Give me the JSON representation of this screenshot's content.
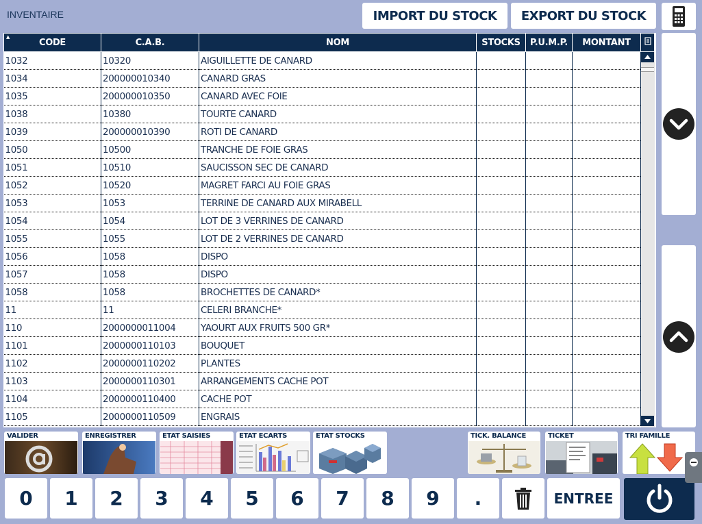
{
  "window": {
    "title": "INVENTAIRE"
  },
  "toolbar": {
    "import_label": "IMPORT DU STOCK",
    "export_label": "EXPORT DU STOCK"
  },
  "table": {
    "columns": [
      "CODE",
      "C.A.B.",
      "NOM",
      "STOCKS",
      "P.U.M.P.",
      "MONTANT"
    ],
    "rows": [
      [
        "1032",
        "10320",
        "AIGUILLETTE DE CANARD",
        "",
        "",
        ""
      ],
      [
        "1034",
        "200000010340",
        "CANARD GRAS",
        "",
        "",
        ""
      ],
      [
        "1035",
        "200000010350",
        "CANARD AVEC FOIE",
        "",
        "",
        ""
      ],
      [
        "1038",
        "10380",
        "TOURTE CANARD",
        "",
        "",
        ""
      ],
      [
        "1039",
        "200000010390",
        "ROTI DE CANARD",
        "",
        "",
        ""
      ],
      [
        "1050",
        "10500",
        "TRANCHE DE FOIE GRAS",
        "",
        "",
        ""
      ],
      [
        "1051",
        "10510",
        "SAUCISSON SEC DE CANARD",
        "",
        "",
        ""
      ],
      [
        "1052",
        "10520",
        "MAGRET FARCI AU FOIE GRAS",
        "",
        "",
        ""
      ],
      [
        "1053",
        "1053",
        "TERRINE DE CANARD AUX MIRABELL",
        "",
        "",
        ""
      ],
      [
        "1054",
        "1054",
        "LOT DE 3 VERRINES DE CANARD",
        "",
        "",
        ""
      ],
      [
        "1055",
        "1055",
        "LOT DE 2 VERRINES DE CANARD",
        "",
        "",
        ""
      ],
      [
        "1056",
        "1058",
        "DISPO",
        "",
        "",
        ""
      ],
      [
        "1057",
        "1058",
        "DISPO",
        "",
        "",
        ""
      ],
      [
        "1058",
        "1058",
        "BROCHETTES DE CANARD*",
        "",
        "",
        ""
      ],
      [
        "11",
        "11",
        "CELERI BRANCHE*",
        "",
        "",
        ""
      ],
      [
        "110",
        "2000000011004",
        "YAOURT AUX FRUITS 500 GR*",
        "",
        "",
        ""
      ],
      [
        "1101",
        "2000000110103",
        "BOUQUET",
        "",
        "",
        ""
      ],
      [
        "1102",
        "2000000110202",
        "PLANTES",
        "",
        "",
        ""
      ],
      [
        "1103",
        "2000000110301",
        "ARRANGEMENTS CACHE POT",
        "",
        "",
        ""
      ],
      [
        "1104",
        "2000000110400",
        "CACHE POT",
        "",
        "",
        ""
      ],
      [
        "1105",
        "2000000110509",
        "ENGRAIS",
        "",
        "",
        ""
      ]
    ]
  },
  "functions": {
    "valider": "VALIDER",
    "enregistrer": "ENREGISTRER",
    "etat_saisies": "ETAT SAISIES",
    "etat_ecarts": "ETAT ECARTS",
    "etat_stocks": "ETAT STOCKS",
    "tick_balance": "TICK. BALANCE",
    "ticket": "TICKET",
    "tri_famille": "TRI FAMILLE"
  },
  "keypad": {
    "keys": [
      "0",
      "1",
      "2",
      "3",
      "4",
      "5",
      "6",
      "7",
      "8",
      "9",
      "."
    ],
    "entree": "ENTREE"
  },
  "icons": {
    "calculator": "calculator-icon",
    "scroll_down": "chevron-down-icon",
    "scroll_up": "chevron-up-icon",
    "delete": "trash-icon",
    "power": "power-icon"
  },
  "colors": {
    "header": "#0d2b4e",
    "background": "#a3aed3",
    "accent_text": "#0d2b4e"
  }
}
